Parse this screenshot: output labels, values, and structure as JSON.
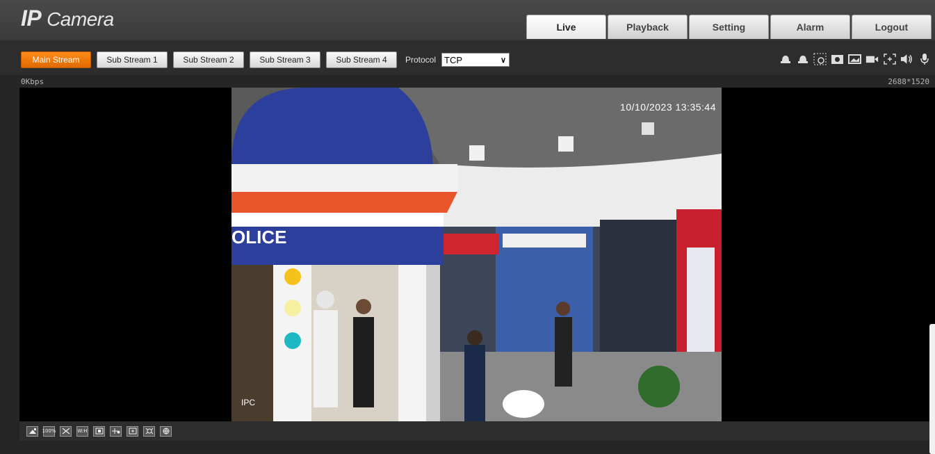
{
  "app": {
    "logo_ip": "IP",
    "logo_camera": "Camera"
  },
  "nav": {
    "tabs": [
      {
        "label": "Live",
        "active": true
      },
      {
        "label": "Playback"
      },
      {
        "label": "Setting"
      },
      {
        "label": "Alarm"
      },
      {
        "label": "Logout"
      }
    ]
  },
  "toolbar": {
    "streams": [
      "Main Stream",
      "Sub Stream 1",
      "Sub Stream 2",
      "Sub Stream 3",
      "Sub Stream 4"
    ],
    "active_stream": "Main Stream",
    "protocol_label": "Protocol",
    "protocol_value": "TCP",
    "icons": [
      "alarm-bell-icon",
      "alarm-bell-icon",
      "region-zoom-icon",
      "snapshot-icon",
      "image-icon",
      "record-icon",
      "fullscreen-icon",
      "speaker-icon",
      "microphone-icon"
    ]
  },
  "status": {
    "bitrate": "0Kbps",
    "resolution": "2688*1520"
  },
  "video": {
    "osd_time": "10/10/2023 13:35:44",
    "osd_channel": "IPC",
    "scene_text": "OLICE"
  },
  "bottom_tools": [
    "Original",
    "100%",
    "Fit",
    "W:H",
    "Zoom",
    "PTZ",
    "Crosshair",
    "Fisheye",
    "Globe"
  ],
  "colors": {
    "accent": "#ff8c1a",
    "background": "#262626"
  }
}
